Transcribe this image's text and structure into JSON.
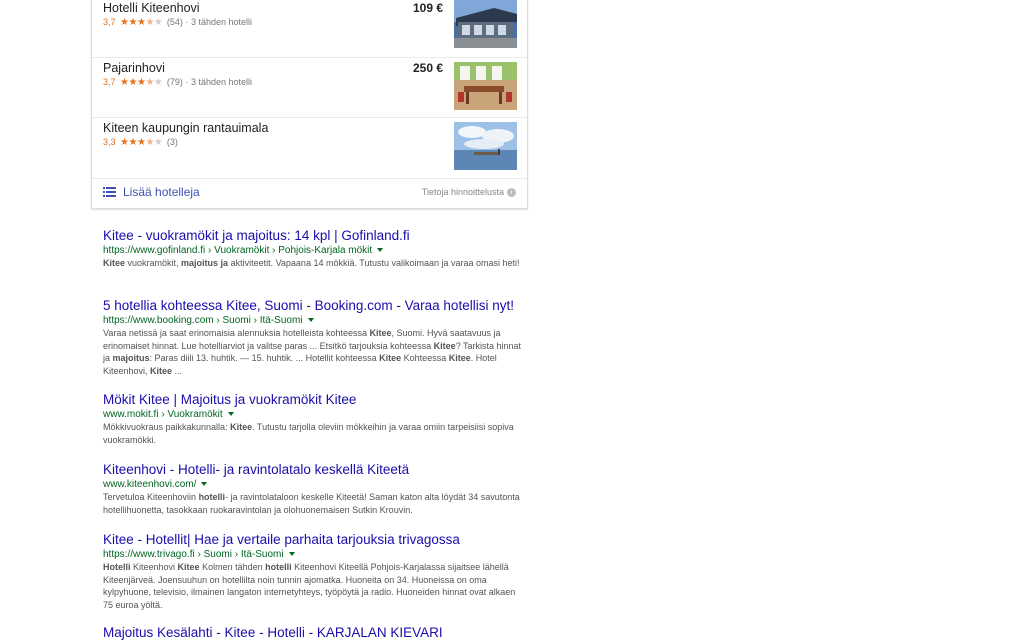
{
  "hotels": [
    {
      "name": "Hotelli Kiteenhovi",
      "rating": "3,7",
      "reviews": "(54)",
      "sep": "·",
      "category": "3 tähden hotelli",
      "price": "109 €",
      "stars_full": 3,
      "stars_half": 1
    },
    {
      "name": "Pajarinhovi",
      "rating": "3,7",
      "reviews": "(79)",
      "sep": "·",
      "category": "3 tähden hotelli",
      "price": "250 €",
      "stars_full": 3,
      "stars_half": 1
    },
    {
      "name": "Kiteen kaupungin rantauimala",
      "rating": "3,3",
      "reviews": "(3)",
      "sep": "",
      "category": "",
      "price": "",
      "stars_full": 3,
      "stars_half": 1
    }
  ],
  "more_hotels": {
    "label": "Lisää hotelleja",
    "pricing": "Tietoja hinnoittelusta",
    "icon": "list-icon"
  },
  "results": [
    {
      "title": "Kitee - vuokramökit ja majoitus: 14 kpl | Gofinland.fi",
      "url": "https://www.gofinland.fi › Vuokramökit › Pohjois-Karjala mökit",
      "snippet": "<b>Kitee</b> vuokramökit, <b>majoitus ja</b> aktiviteetit. Vapaana 14 mökkiä. Tutustu valikoimaan ja varaa omasi heti!"
    },
    {
      "title": "5 hotellia kohteessa Kitee, Suomi - Booking.com - Varaa hotellisi nyt!",
      "url": "https://www.booking.com › Suomi › Itä-Suomi",
      "snippet": "Varaa netissä ja saat erinomaisia alennuksia hotelleista kohteessa <b>Kitee</b>, Suomi. Hyvä saatavuus ja erinomaiset hinnat. Lue hotelliarviot ja valitse paras ... Etsitkö tarjouksia kohteessa <b>Kitee</b>? Tarkista hinnat ja <b>majoitus</b>: Paras diili 13. huhtik. — 15. huhtik. ... Hotellit kohteessa <b>Kitee</b> Kohteessa <b>Kitee</b>. Hotel Kiteenhovi, <b>Kitee</b> ..."
    },
    {
      "title": "Mökit Kitee | Majoitus ja vuokramökit Kitee",
      "url": "www.mokit.fi › Vuokramökit",
      "snippet": "Mökkivuokraus paikkakunnalla: <b>Kitee</b>. Tutustu tarjolla oleviin mökkeihin ja varaa omiin tarpeisiisi sopiva vuokramökki."
    },
    {
      "title": "Kiteenhovi - Hotelli- ja ravintolatalo keskellä Kiteetä",
      "url": "www.kiteenhovi.com/",
      "snippet": "Tervetuloa Kiteenhoviin <b>hotelli</b>- ja ravintolataloon keskelle Kiteetä! Saman katon alta löydät 34 savutonta hotellihuonetta, tasokkaan ruokaravintolan ja olohuonemaisen Sutkin Krouvin."
    },
    {
      "title": "Kitee - Hotellit| Hae ja vertaile parhaita tarjouksia trivagossa",
      "url": "https://www.trivago.fi › Suomi › Itä-Suomi",
      "snippet": "<b>Hotelli</b> Kiteenhovi <b>Kitee</b> Kolmen tähden <b>hotelli</b> Kiteenhovi Kiteellä Pohjois-Karjalassa sijaitsee lähellä Kiteenjärveä. Joensuuhun on hotellilta noin tunnin ajomatka. Huoneita on 34. Huoneissa on oma kylpyhuone, televisio, ilmainen langaton internetyhteys, työpöytä ja radio. Huoneiden hinnat ovat alkaen 75 euroa yöltä."
    },
    {
      "title": "Majoitus Kesälahti - Kitee - Hotelli - KARJALAN KIEVARI",
      "url": "",
      "snippet": ""
    }
  ],
  "colors": {
    "link": "#1a0dab",
    "url": "#006621",
    "star": "#e7711b",
    "accent": "#3f51b5"
  }
}
